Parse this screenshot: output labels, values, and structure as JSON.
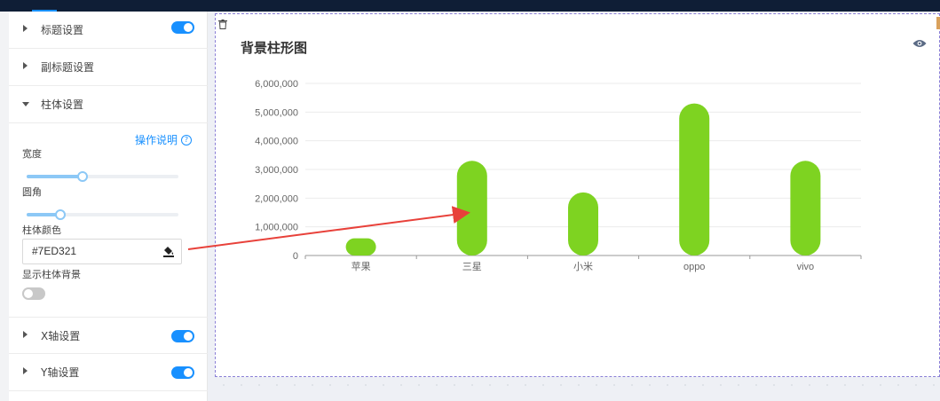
{
  "panel": {
    "sections": {
      "title": {
        "label": "标题设置",
        "enabled": true
      },
      "subtitle": {
        "label": "副标题设置"
      },
      "bar": {
        "label": "柱体设置"
      },
      "xaxis": {
        "label": "X轴设置",
        "enabled": true
      },
      "yaxis": {
        "label": "Y轴设置",
        "enabled": true
      }
    },
    "help_label": "操作说明",
    "help_icon": "question-circle-icon",
    "width_label": "宽度",
    "width_value": 0.37,
    "radius_label": "圆角",
    "radius_value": 0.22,
    "color_label": "柱体颜色",
    "color_value": "#7ED321",
    "show_bg_label": "显示柱体背景",
    "show_bg_enabled": false
  },
  "colors": {
    "accent": "#1890ff",
    "bar": "#7ED321",
    "arrow": "#e8413a"
  },
  "chart_data": {
    "type": "bar",
    "title": "背景柱形图",
    "categories": [
      "苹果",
      "三星",
      "小米",
      "oppo",
      "vivo"
    ],
    "values": [
      600000,
      3300000,
      2200000,
      5300000,
      3300000
    ],
    "yticks": [
      "0",
      "1,000,000",
      "2,000,000",
      "3,000,000",
      "4,000,000",
      "5,000,000",
      "6,000,000"
    ],
    "ylim": [
      0,
      6000000
    ],
    "grid": true,
    "bar_color": "#7ED321"
  }
}
